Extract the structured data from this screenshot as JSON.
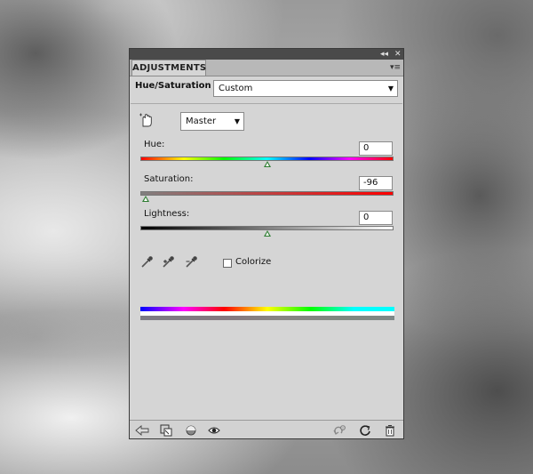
{
  "panel": {
    "collapse_glyph": "◂◂",
    "close_glyph": "✕",
    "tab_label": "ADJUSTMENTS",
    "menu_glyph": "▾≡"
  },
  "preset": {
    "title": "Hue/Saturation",
    "value": "Custom"
  },
  "channel": {
    "value": "Master"
  },
  "hue": {
    "label": "Hue:",
    "value": "0",
    "fraction": 0.5
  },
  "saturation": {
    "label": "Saturation:",
    "value": "-96",
    "fraction": 0.02
  },
  "lightness": {
    "label": "Lightness:",
    "value": "0",
    "fraction": 0.5
  },
  "colorize": {
    "label": "Colorize",
    "checked": false
  },
  "icons": {
    "targeted_adjustment": "hand-scrub-icon",
    "eyedropper": "eyedropper-icon",
    "eyedropper_add": "eyedropper-plus-icon",
    "eyedropper_subtract": "eyedropper-minus-icon",
    "back": "back-arrow-icon",
    "clip": "clip-to-layer-icon",
    "visibility_toggle": "layer-visibility-icon",
    "view_previous": "eye-icon",
    "reset_previous": "reset-previous-icon",
    "reset": "reset-icon",
    "delete": "trash-icon"
  },
  "colors": {
    "thumb": "#2e7d32",
    "panel_bg": "#d5d5d5"
  }
}
